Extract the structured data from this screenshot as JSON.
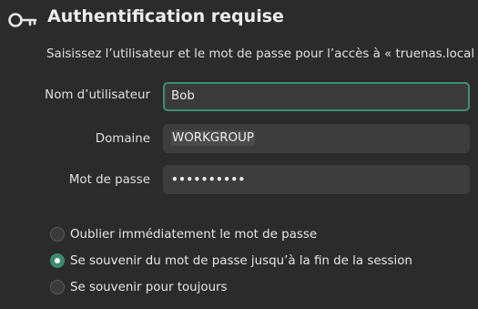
{
  "dialog": {
    "title": "Authentification requise",
    "subtitle": "Saisissez l’utilisateur et le mot de passe pour l’accès à « truenas.local » :",
    "icon": "key-icon"
  },
  "fields": {
    "username": {
      "label": "Nom d’utilisateur",
      "value": "Bob"
    },
    "domain": {
      "label": "Domaine",
      "value": "WORKGROUP"
    },
    "password": {
      "label": "Mot de passe",
      "value": "••••••••••"
    }
  },
  "password_options": [
    {
      "label": "Oublier immédiatement le mot de passe",
      "checked": false
    },
    {
      "label": "Se souvenir du mot de passe jusqu’à la fin de la session",
      "checked": true
    },
    {
      "label": "Se souvenir pour toujours",
      "checked": false
    }
  ],
  "colors": {
    "accent": "#3d8b6f",
    "background": "#2b2b2b",
    "input_background": "#3d3d3d"
  }
}
